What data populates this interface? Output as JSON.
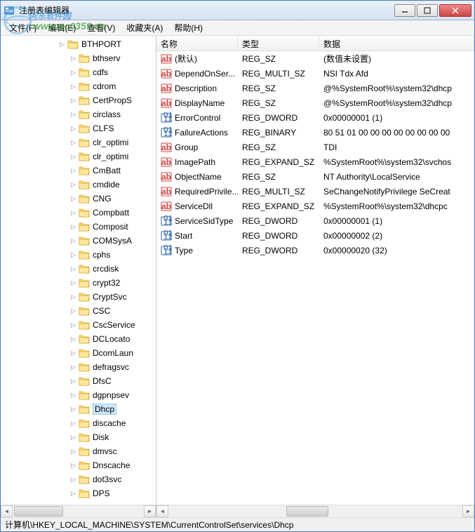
{
  "window": {
    "title": "注册表编辑器"
  },
  "watermark": {
    "text": "河东软件园",
    "url": "www.pc0359.cn"
  },
  "menu": {
    "file": "文件(F)",
    "edit": "编辑(E)",
    "view": "查看(V)",
    "favorites": "收藏夹(A)",
    "help": "帮助(H)"
  },
  "tree": {
    "items": [
      {
        "label": "BTHPORT",
        "first": true
      },
      {
        "label": "bthserv"
      },
      {
        "label": "cdfs"
      },
      {
        "label": "cdrom"
      },
      {
        "label": "CertPropS"
      },
      {
        "label": "circlass"
      },
      {
        "label": "CLFS"
      },
      {
        "label": "clr_optimi"
      },
      {
        "label": "clr_optimi"
      },
      {
        "label": "CmBatt"
      },
      {
        "label": "cmdide"
      },
      {
        "label": "CNG"
      },
      {
        "label": "Compbatt"
      },
      {
        "label": "Composit"
      },
      {
        "label": "COMSysA"
      },
      {
        "label": "cphs"
      },
      {
        "label": "crcdisk"
      },
      {
        "label": "crypt32"
      },
      {
        "label": "CryptSvc"
      },
      {
        "label": "CSC"
      },
      {
        "label": "CscService"
      },
      {
        "label": "DCLocato"
      },
      {
        "label": "DcomLaun"
      },
      {
        "label": "defragsvc"
      },
      {
        "label": "DfsC"
      },
      {
        "label": "dgpnpsev"
      },
      {
        "label": "Dhcp",
        "selected": true
      },
      {
        "label": "discache"
      },
      {
        "label": "Disk"
      },
      {
        "label": "dmvsc"
      },
      {
        "label": "Dnscache"
      },
      {
        "label": "dot3svc"
      },
      {
        "label": "DPS"
      }
    ]
  },
  "list": {
    "headers": {
      "name": "名称",
      "type": "类型",
      "data": "数据"
    },
    "rows": [
      {
        "icon": "str",
        "name": "(默认)",
        "type": "REG_SZ",
        "data": "(数值未设置)"
      },
      {
        "icon": "str",
        "name": "DependOnSer...",
        "type": "REG_MULTI_SZ",
        "data": "NSI Tdx Afd"
      },
      {
        "icon": "str",
        "name": "Description",
        "type": "REG_SZ",
        "data": "@%SystemRoot%\\system32\\dhcp"
      },
      {
        "icon": "str",
        "name": "DisplayName",
        "type": "REG_SZ",
        "data": "@%SystemRoot%\\system32\\dhcp"
      },
      {
        "icon": "bin",
        "name": "ErrorControl",
        "type": "REG_DWORD",
        "data": "0x00000001 (1)"
      },
      {
        "icon": "bin",
        "name": "FailureActions",
        "type": "REG_BINARY",
        "data": "80 51 01 00 00 00 00 00 00 00 00"
      },
      {
        "icon": "str",
        "name": "Group",
        "type": "REG_SZ",
        "data": "TDI"
      },
      {
        "icon": "str",
        "name": "ImagePath",
        "type": "REG_EXPAND_SZ",
        "data": "%SystemRoot%\\system32\\svchos"
      },
      {
        "icon": "str",
        "name": "ObjectName",
        "type": "REG_SZ",
        "data": "NT Authority\\LocalService"
      },
      {
        "icon": "str",
        "name": "RequiredPrivile...",
        "type": "REG_MULTI_SZ",
        "data": "SeChangeNotifyPrivilege SeCreat"
      },
      {
        "icon": "str",
        "name": "ServiceDll",
        "type": "REG_EXPAND_SZ",
        "data": "%SystemRoot%\\system32\\dhcpc"
      },
      {
        "icon": "bin",
        "name": "ServiceSidType",
        "type": "REG_DWORD",
        "data": "0x00000001 (1)"
      },
      {
        "icon": "bin",
        "name": "Start",
        "type": "REG_DWORD",
        "data": "0x00000002 (2)"
      },
      {
        "icon": "bin",
        "name": "Type",
        "type": "REG_DWORD",
        "data": "0x00000020 (32)"
      }
    ]
  },
  "statusbar": {
    "path": "计算机\\HKEY_LOCAL_MACHINE\\SYSTEM\\CurrentControlSet\\services\\Dhcp"
  }
}
